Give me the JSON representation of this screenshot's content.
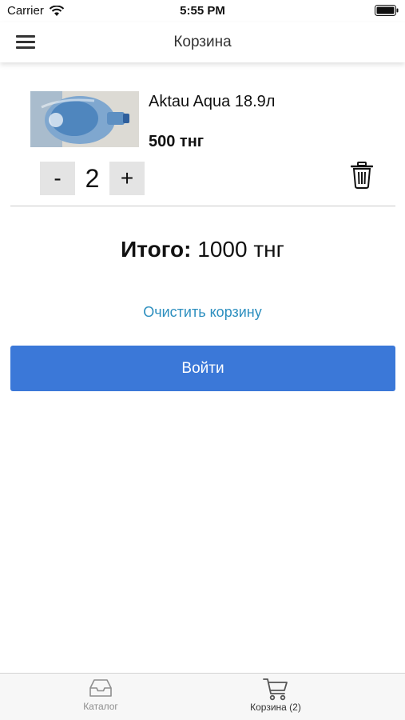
{
  "status_bar": {
    "carrier": "Carrier",
    "time": "5:55 PM"
  },
  "header": {
    "title": "Корзина"
  },
  "cart": {
    "items": [
      {
        "name": "Aktau Aqua 18.9л",
        "price": "500 тнг",
        "quantity": "2",
        "minus_label": "-",
        "plus_label": "+"
      }
    ]
  },
  "total": {
    "label": "Итого:",
    "value": "1000 тнг"
  },
  "actions": {
    "clear_cart": "Очистить корзину",
    "login": "Войти"
  },
  "tab_bar": {
    "tabs": [
      {
        "label": "Каталог",
        "icon": "inbox-icon"
      },
      {
        "label": "Корзина (2)",
        "icon": "cart-icon"
      }
    ]
  },
  "colors": {
    "accent": "#3b78d8",
    "link": "#2d8fbf",
    "tab_bar_bg": "#f7f7f7"
  }
}
